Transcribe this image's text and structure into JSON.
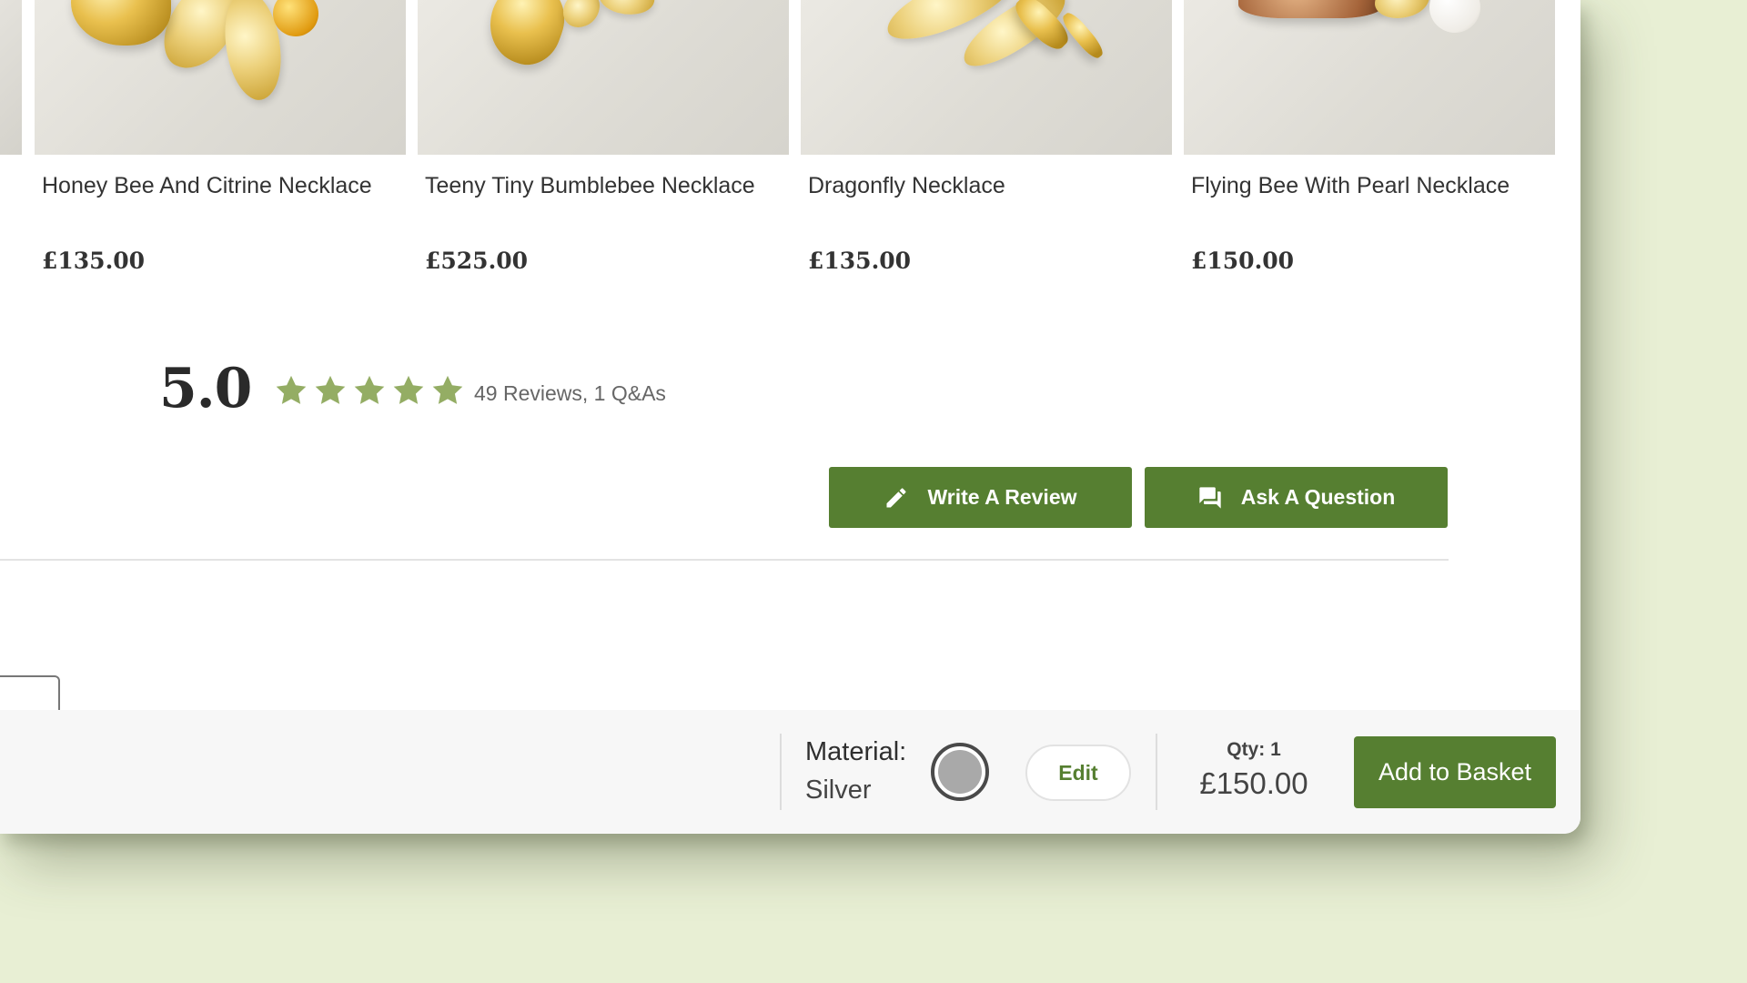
{
  "products": [
    {
      "name": "Honey Bee And Citrine Necklace",
      "price": "£135.00"
    },
    {
      "name": "Teeny Tiny Bumblebee Necklace",
      "price": "£525.00"
    },
    {
      "name": "Dragonfly Necklace",
      "price": "£135.00"
    },
    {
      "name": "Flying Bee With Pearl Necklace",
      "price": "£150.00"
    }
  ],
  "reviews": {
    "score": "5.0",
    "stars": 5,
    "summary": "49 Reviews, 1 Q&As",
    "star_color": "#94ad64",
    "write_label": "Write A Review",
    "ask_label": "Ask A Question"
  },
  "purchase_bar": {
    "material_label": "Material:",
    "material_value": "Silver",
    "edit_label": "Edit",
    "qty": "Qty: 1",
    "price": "£150.00",
    "add_label": "Add to Basket"
  },
  "colors": {
    "accent_green": "#567f31",
    "background": "#e8efd4"
  },
  "icons": {
    "write": "pencil-icon",
    "ask": "chat-bubbles-icon",
    "star": "star-icon"
  }
}
